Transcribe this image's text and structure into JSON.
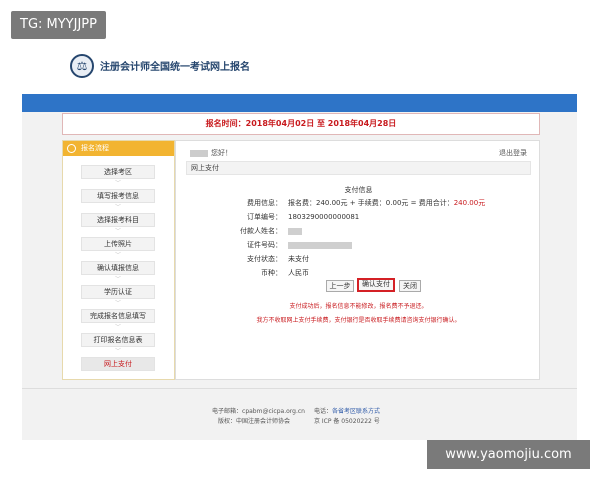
{
  "tag": "TG: MYYJJPP",
  "watermark": "www.yaomojiu.com",
  "header": {
    "title": "注册会计师全国统一考试网上报名"
  },
  "notice": {
    "text": "报名时间：2018年04月02日 至 2018年04月28日"
  },
  "sidebar": {
    "title": "报名流程",
    "items": [
      {
        "label": "选择考区"
      },
      {
        "label": "填写报考信息"
      },
      {
        "label": "选择报考科目"
      },
      {
        "label": "上传照片"
      },
      {
        "label": "确认填报信息"
      },
      {
        "label": "学历认证"
      },
      {
        "label": "完成报名信息填写"
      },
      {
        "label": "打印报名信息表"
      },
      {
        "label": "网上支付"
      }
    ]
  },
  "panel": {
    "greeting": "您好！",
    "logout": "退出登录",
    "section": "网上支付",
    "pay_title": "支付信息",
    "fee_label": "费用信息：",
    "fee_value": "报名费：240.00元 + 手续费：0.00元 = 费用合计：",
    "fee_total": "240.00元",
    "order_label": "订单编号：",
    "order_value": "1803290000000081",
    "payer_label": "付款人姓名：",
    "id_label": "证件号码：",
    "status_label": "支付状态：",
    "status_value": "未支付",
    "currency_label": "币种：",
    "currency_value": "人民币",
    "buttons": {
      "prev": "上一步",
      "confirm": "确认支付",
      "close": "关闭"
    },
    "warn1": "支付成功后，报名信息不能修改，报名费不予退还。",
    "warn2": "我方不收取网上支付手续费，支付银行是否收取手续费请咨询支付银行确认。"
  },
  "footer": {
    "email_label": "电子邮箱：",
    "email_value": "cpabm@cicpa.org.cn",
    "phone_label": "电话：",
    "phone_value": "各省考区联系方式",
    "org_label": "版权：",
    "org_value": "中国注册会计师协会",
    "icp": "京 ICP 备 05020222 号"
  }
}
